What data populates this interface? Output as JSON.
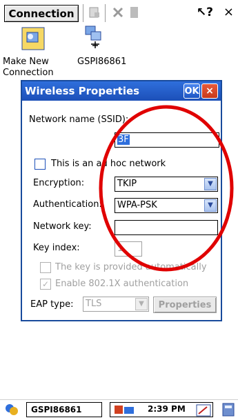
{
  "toolbar": {
    "connection_label": "Connection",
    "help_label": "?",
    "close_label": "×"
  },
  "desktop": {
    "icons": [
      {
        "label": "Make New Connection"
      },
      {
        "label": "GSPI86861"
      }
    ]
  },
  "dialog": {
    "title": "Wireless Properties",
    "ok_label": "OK",
    "close_label": "×",
    "ssid_label": "Network name (SSID):",
    "ssid_value": "3F",
    "adhoc_label": "This is an ad hoc network",
    "encryption_label": "Encryption:",
    "encryption_value": "TKIP",
    "authentication_label": "Authentication:",
    "authentication_value": "WPA-PSK",
    "network_key_label": "Network key:",
    "network_key_value": "",
    "key_index_label": "Key index:",
    "key_index_value": "1",
    "auto_key_label": "The key is provided automatically",
    "enable_8021x_label": "Enable 802.1X authentication",
    "eap_type_label": "EAP type:",
    "eap_type_value": "TLS",
    "properties_label": "Properties"
  },
  "taskbar": {
    "network_name": "GSPI86861",
    "time": "2:39 PM"
  },
  "colors": {
    "title_blue": "#1c4fb8",
    "annotation_red": "#e00000",
    "close_red": "#d04020"
  }
}
